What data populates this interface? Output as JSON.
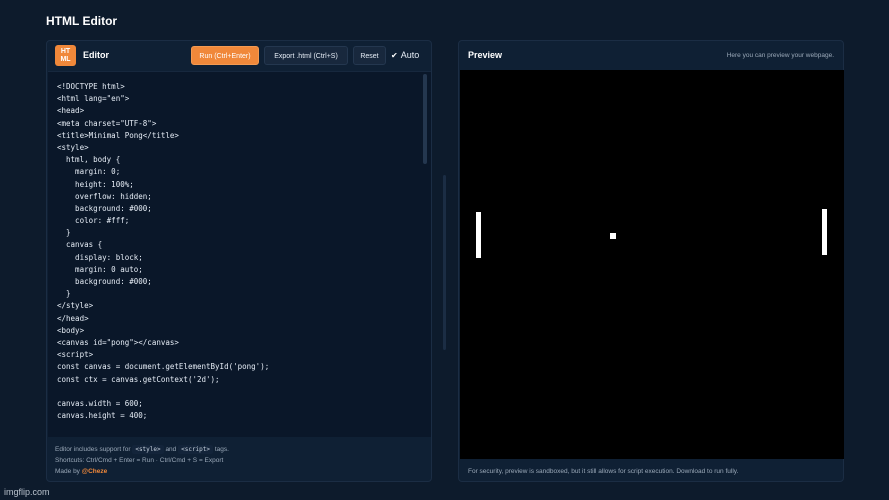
{
  "app": {
    "title": "HTML Editor"
  },
  "editor": {
    "logo_line1": "HT",
    "logo_line2": "ML",
    "label": "Editor",
    "run_label": "Run (Ctrl+Enter)",
    "export_label": "Export .html (Ctrl+S)",
    "reset_label": "Reset",
    "auto_check": "✔",
    "auto_label": "Auto",
    "code_lines": [
      "<!DOCTYPE html>",
      "<html lang=\"en\">",
      "<head>",
      "<meta charset=\"UTF-8\">",
      "<title>Minimal Pong</title>",
      "<style>",
      "  html, body {",
      "    margin: 0;",
      "    height: 100%;",
      "    overflow: hidden;",
      "    background: #000;",
      "    color: #fff;",
      "  }",
      "  canvas {",
      "    display: block;",
      "    margin: 0 auto;",
      "    background: #000;",
      "  }",
      "</style>",
      "</head>",
      "<body>",
      "<canvas id=\"pong\"></canvas>",
      "<script>",
      "const canvas = document.getElementById('pong');",
      "const ctx = canvas.getContext('2d');",
      "",
      "canvas.width = 600;",
      "canvas.height = 400;"
    ],
    "footer": {
      "support_prefix": "Editor includes support for",
      "style_tag": "<style>",
      "and": "and",
      "script_tag": "<script>",
      "tags_suffix": "tags.",
      "shortcuts": "Shortcuts: Ctrl/Cmd + Enter = Run · Ctrl/Cmd + S = Export",
      "made_by": "Made by",
      "author": "@Cheze"
    }
  },
  "preview": {
    "label": "Preview",
    "hint": "Here you can preview your webpage.",
    "footer": "For security, preview is sandboxed, but it still allows for script execution. Download to run fully."
  },
  "watermark": "imgflip.com"
}
